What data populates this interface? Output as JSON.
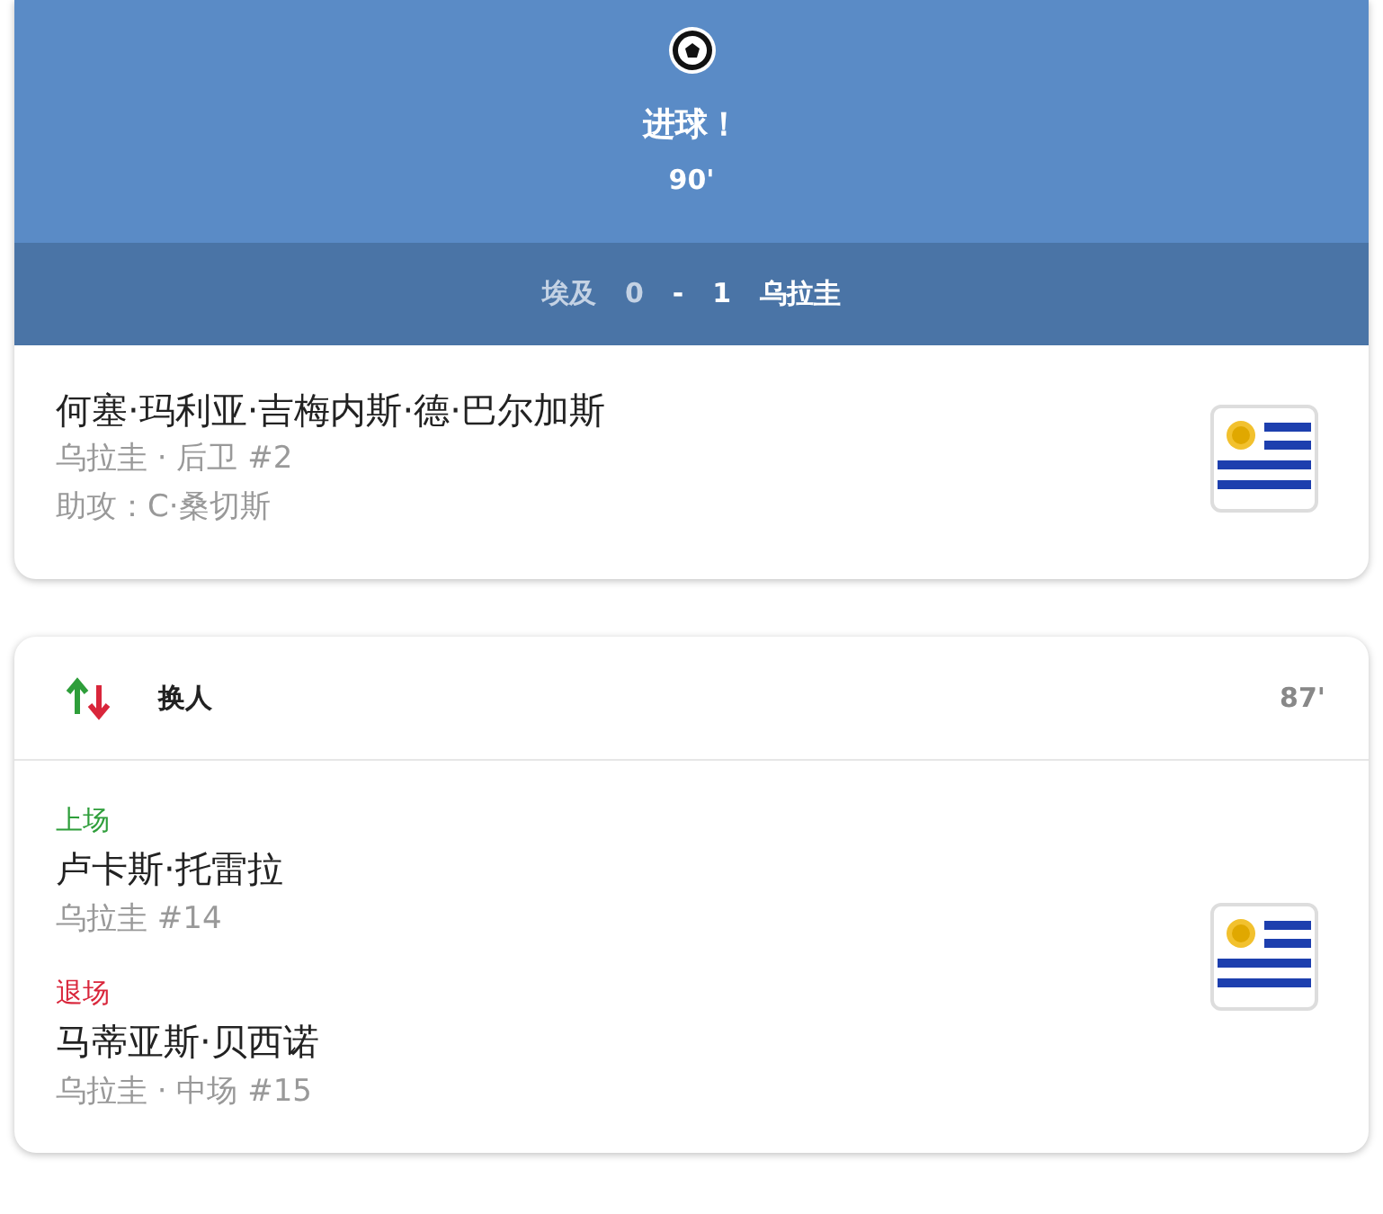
{
  "goal": {
    "title": "进球！",
    "minute": "90'"
  },
  "score": {
    "teams": [
      {
        "name": "埃及",
        "score": "0",
        "leading": false
      },
      {
        "name": "乌拉圭",
        "score": "1",
        "leading": true
      }
    ],
    "separator": "-"
  },
  "scorer": {
    "name": "何塞·玛利亚·吉梅内斯·德·巴尔加斯",
    "detail": "乌拉圭 · 后卫 #2",
    "assist": "助攻：C·桑切斯"
  },
  "substitution": {
    "title": "换人",
    "minute": "87'",
    "players": [
      {
        "kind": "in",
        "label": "上场",
        "name": "卢卡斯·托雷拉",
        "detail": "乌拉圭 #14"
      },
      {
        "kind": "out",
        "label": "退场",
        "name": "马蒂亚斯·贝西诺",
        "detail": "乌拉圭 · 中场 #15"
      }
    ]
  }
}
